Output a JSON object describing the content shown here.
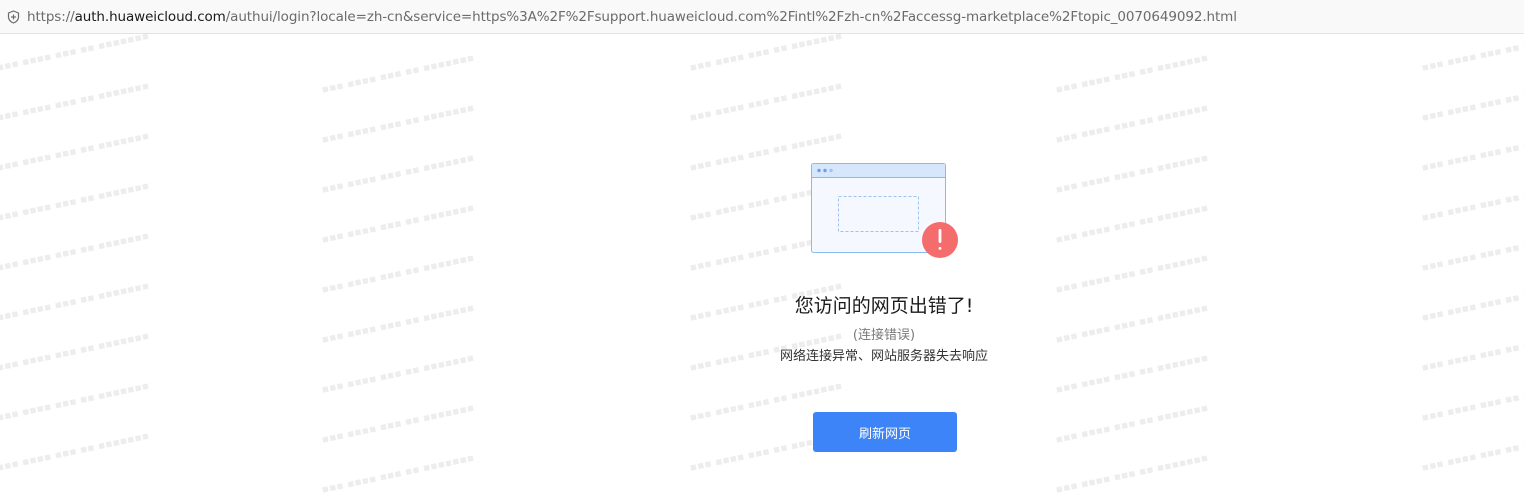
{
  "browser": {
    "url_scheme": "https://",
    "url_host": "auth.huaweicloud.com",
    "url_path": "/authui/login?locale=zh-cn&service=https%3A%2F%2Fsupport.huaweicloud.com%2Fintl%2Fzh-cn%2Faccessg-marketplace%2Ftopic_0070649092.html",
    "security_icon": "shield-icon"
  },
  "error_page": {
    "illustration_icon": "browser-window-error-icon",
    "title": "您访问的网页出错了!",
    "subtitle": "(连接错误)",
    "description": "网络连接异常、网站服务器失去响应",
    "refresh_label": "刷新网页"
  },
  "colors": {
    "accent": "#3c84f8",
    "error": "#f46c6c",
    "illustration_border": "#8cb8f0"
  }
}
